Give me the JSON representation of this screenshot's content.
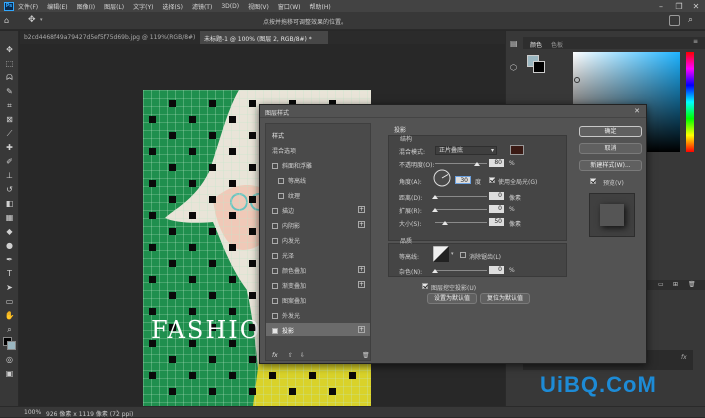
{
  "menubar": {
    "logo": "Ps",
    "items": [
      "文件(F)",
      "编辑(E)",
      "图像(I)",
      "图层(L)",
      "文字(Y)",
      "选择(S)",
      "滤镜(T)",
      "3D(D)",
      "视图(V)",
      "窗口(W)",
      "帮助(H)"
    ]
  },
  "optbar": {
    "hint": "点按并拖移可调整效果的位置。"
  },
  "tabs": [
    {
      "label": "b2cd4468f49a79427d5ef5f75d69b.jpg @ 119%(RGB/8#)",
      "active": false
    },
    {
      "label": "未标题-1 @ 100% (图层 2, RGB/8#) *",
      "active": true
    }
  ],
  "artwork": {
    "text": "FASHIO"
  },
  "status": {
    "zoom": "100%",
    "docinfo": "926 像素 x 1119 像素 (72 ppi)"
  },
  "colorpanel": {
    "tabs": [
      "颜色",
      "色板"
    ]
  },
  "dialog": {
    "title": "图层样式",
    "close": "✕",
    "left_header": "样式",
    "blend_options": "混合选项",
    "items": [
      {
        "label": "斜面和浮雕",
        "checked": false,
        "plus": false,
        "sub": false
      },
      {
        "label": "等高线",
        "checked": false,
        "plus": false,
        "sub": true
      },
      {
        "label": "纹理",
        "checked": false,
        "plus": false,
        "sub": true
      },
      {
        "label": "描边",
        "checked": false,
        "plus": true,
        "sub": false
      },
      {
        "label": "内阴影",
        "checked": false,
        "plus": true,
        "sub": false
      },
      {
        "label": "内发光",
        "checked": false,
        "plus": false,
        "sub": false
      },
      {
        "label": "光泽",
        "checked": false,
        "plus": false,
        "sub": false
      },
      {
        "label": "颜色叠加",
        "checked": false,
        "plus": true,
        "sub": false
      },
      {
        "label": "渐变叠加",
        "checked": false,
        "plus": true,
        "sub": false
      },
      {
        "label": "图案叠加",
        "checked": false,
        "plus": false,
        "sub": false
      },
      {
        "label": "外发光",
        "checked": false,
        "plus": false,
        "sub": false
      },
      {
        "label": "投影",
        "checked": true,
        "plus": true,
        "sub": false,
        "selected": true
      }
    ],
    "bottom_fx": "fx",
    "section_title": "投影",
    "structure": {
      "title": "结构",
      "blend_mode_label": "混合模式:",
      "blend_mode_value": "正片叠底",
      "shadow_color": "#3a1a14",
      "opacity_label": "不透明度(O):",
      "opacity_value": "80",
      "opacity_pct": 0.8,
      "angle_label": "角度(A):",
      "angle_value": "30",
      "angle_unit": "度",
      "global_light_label": "使用全局光(G)",
      "distance_label": "距离(D):",
      "distance_value": "0",
      "distance_unit": "像素",
      "spread_label": "扩展(R):",
      "spread_value": "0",
      "spread_unit": "%",
      "size_label": "大小(S):",
      "size_value": "50",
      "size_unit": "像素",
      "size_pct": 0.2
    },
    "quality": {
      "title": "品质",
      "contour_label": "等高线:",
      "antialias_label": "消除锯齿(L)",
      "noise_label": "杂色(N):",
      "noise_value": "0",
      "noise_unit": "%",
      "knockout_label": "图层挖空投影(U)",
      "set_default": "设置为默认值",
      "reset_default": "复位为默认值"
    },
    "buttons": {
      "ok": "确定",
      "cancel": "取消",
      "new_style": "新建样式(W)...",
      "preview": "预览(V)"
    },
    "pct_sign": "%"
  },
  "watermark": "UiBQ.CoM"
}
